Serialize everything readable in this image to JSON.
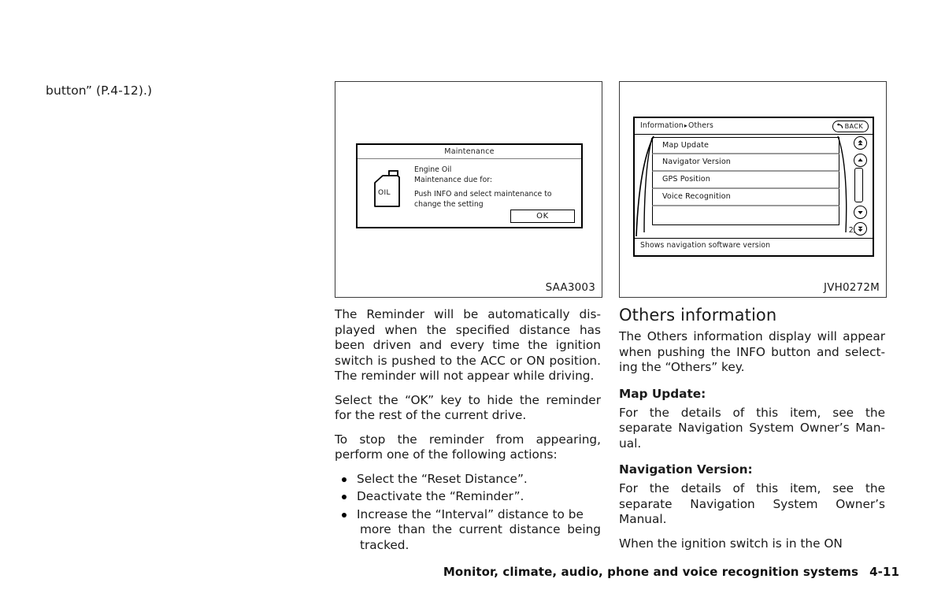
{
  "top_left_text": "button” (P.4-12).)",
  "figures": {
    "left": {
      "code": "SAA3003",
      "dialog": {
        "title": "Maintenance",
        "icon_label": "OIL",
        "line1": "Engine Oil",
        "line2": "Maintenance due for:",
        "line3": "Push INFO and select maintenance to",
        "line4": "change the setting",
        "ok_label": "OK"
      }
    },
    "right": {
      "code": "JVH0272M",
      "screen": {
        "breadcrumb_root": "Information",
        "breadcrumb_arrow": "▸",
        "breadcrumb_leaf": "Others",
        "back_label": "BACK",
        "items": [
          {
            "label": "Map Update"
          },
          {
            "label": "Navigator Version"
          },
          {
            "label": "GPS Position"
          },
          {
            "label": "Voice Recognition"
          }
        ],
        "page_count": "2/4",
        "status_text": "Shows navigation software version",
        "scroll_buttons": [
          "page-up-icon",
          "scroll-up-icon",
          "scroll-down-icon",
          "page-down-icon"
        ]
      }
    }
  },
  "left_column": {
    "para1": "The Reminder will be automatically dis-played when the specified distance has been driven and every time the ignition switch is pushed to the ACC or ON position. The reminder will not appear while driving.",
    "para2": "Select the “OK” key to hide the reminder for the rest of the current drive.",
    "para3": "To stop the reminder from appearing, perform one of the following actions:",
    "bullets": [
      {
        "text": "Select the “Reset Distance”.",
        "cont": ""
      },
      {
        "text": "Deactivate the “Reminder”.",
        "cont": ""
      },
      {
        "text": "Increase the “Interval” distance to be",
        "cont": "more than the current distance being tracked."
      }
    ]
  },
  "right_column": {
    "heading": "Others information",
    "intro": "The Others information display will appear when pushing the INFO button and select-ing the “Others” key.",
    "sub1_title": "Map Update:",
    "sub1_body": "For the details of this item, see the separate Navigation System Owner’s Man-ual.",
    "sub2_title": "Navigation Version:",
    "sub2_body": "For the details of this item, see the separate Navigation System Owner’s Manual.",
    "para_last": "When the ignition switch is in the ON"
  },
  "footer": {
    "chapter": "Monitor, climate, audio, phone and voice recognition systems",
    "page_number": "4-11"
  }
}
